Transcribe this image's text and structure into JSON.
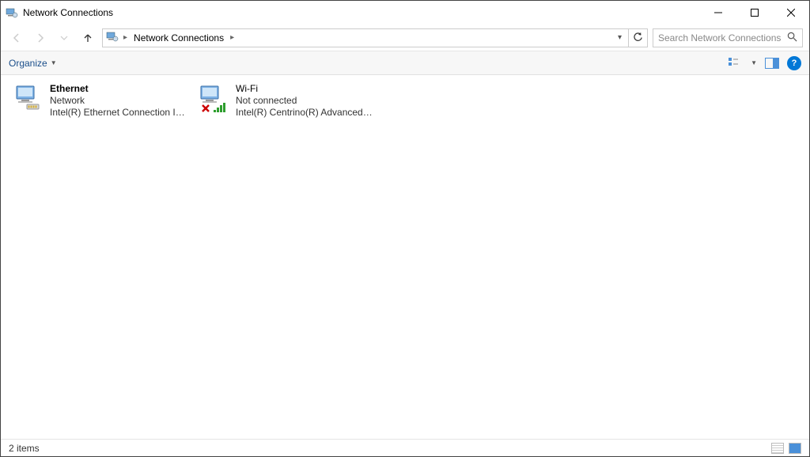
{
  "window": {
    "title": "Network Connections"
  },
  "breadcrumb": {
    "item": "Network Connections"
  },
  "search": {
    "placeholder": "Search Network Connections"
  },
  "toolbar": {
    "organize_label": "Organize"
  },
  "adapters": [
    {
      "name": "Ethernet",
      "status": "Network",
      "device": "Intel(R) Ethernet Connection I217..."
    },
    {
      "name": "Wi-Fi",
      "status": "Not connected",
      "device": "Intel(R) Centrino(R) Advanced-N ..."
    }
  ],
  "statusbar": {
    "count_text": "2 items"
  }
}
